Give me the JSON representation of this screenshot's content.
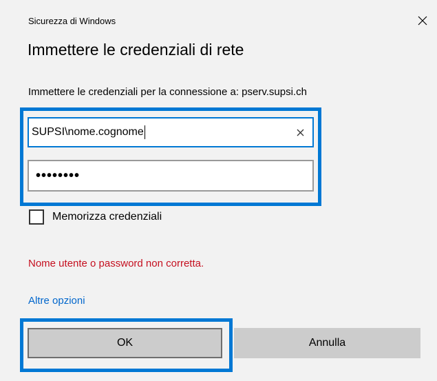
{
  "window": {
    "title": "Sicurezza di Windows",
    "close_icon": "close-icon"
  },
  "dialog": {
    "heading": "Immettere le credenziali di rete",
    "subtitle": "Immettere le credenziali per la connessione a: pserv.supsi.ch"
  },
  "username": {
    "value": "SUPSI\\nome.cognome",
    "clear_icon": "clear-icon"
  },
  "password": {
    "masked_value": "••••••••"
  },
  "remember": {
    "label": "Memorizza credenziali",
    "checked": false
  },
  "error": {
    "message": "Nome utente o password non corretta.",
    "color": "#c50f1f"
  },
  "links": {
    "more_options": "Altre opzioni"
  },
  "buttons": {
    "ok": "OK",
    "cancel": "Annulla"
  },
  "colors": {
    "accent": "#0078d4",
    "background": "#f2f2f2",
    "button": "#cccccc",
    "link": "#0066cc"
  }
}
